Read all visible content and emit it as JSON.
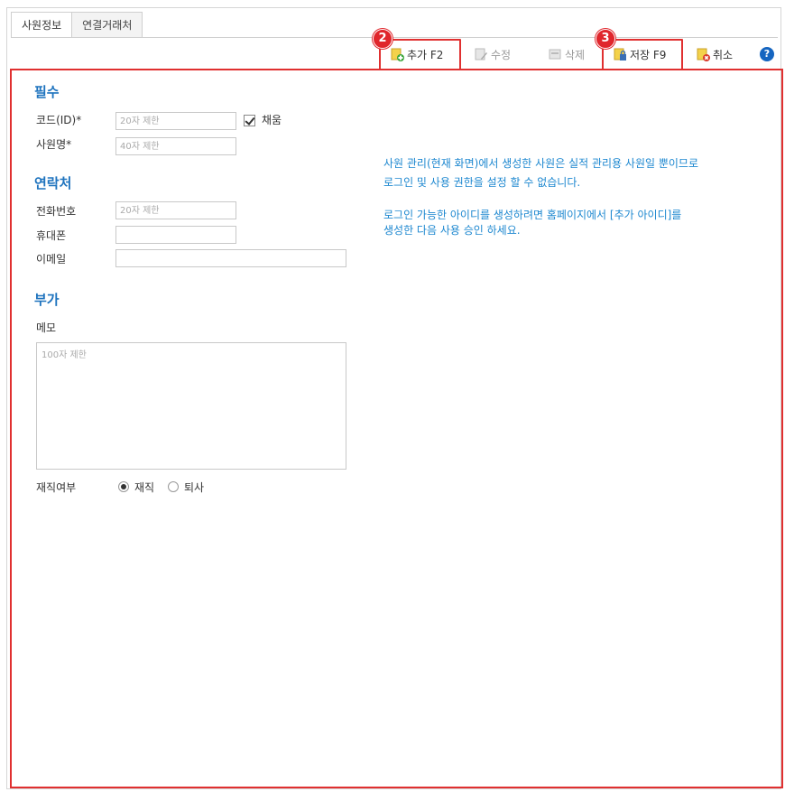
{
  "tabs": [
    {
      "label": "사원정보",
      "active": true
    },
    {
      "label": "연결거래처",
      "active": false
    }
  ],
  "toolbar": {
    "add": "추가 F2",
    "edit": "수정",
    "delete": "삭제",
    "save": "저장 F9",
    "cancel": "취소",
    "help": "?",
    "badges": {
      "add": "2",
      "save": "3"
    }
  },
  "sections": {
    "required": "필수",
    "contact": "연락처",
    "extra": "부가"
  },
  "fields": {
    "code": {
      "label": "코드(ID)*",
      "placeholder": "20자 제한"
    },
    "autonum": {
      "label": "채움",
      "checked": true
    },
    "name": {
      "label": "사원명*",
      "placeholder": "40자 제한"
    },
    "phone": {
      "label": "전화번호",
      "placeholder": "20자 제한"
    },
    "mobile": {
      "label": "휴대폰",
      "placeholder": ""
    },
    "email": {
      "label": "이메일",
      "placeholder": ""
    },
    "memo": {
      "label": "메모",
      "placeholder": "100자 제한"
    },
    "status": {
      "label": "재직여부",
      "options": [
        "재직",
        "퇴사"
      ],
      "selected": "재직"
    }
  },
  "info": {
    "line1": "사원 관리(현재 화면)에서 생성한 사원은 실적 관리용 사원일 뿐이므로",
    "line2": "로그인 및 사용 권한을 설정 할 수 없습니다.",
    "line3": "로그인 가능한 아이디를 생성하려면 홈페이지에서 [추가 아이디]를",
    "line4": "생성한 다음 사용 승인 하세요."
  },
  "colors": {
    "highlight": "#e03030",
    "section_title": "#1e73be",
    "info_text": "#1e88d0"
  }
}
